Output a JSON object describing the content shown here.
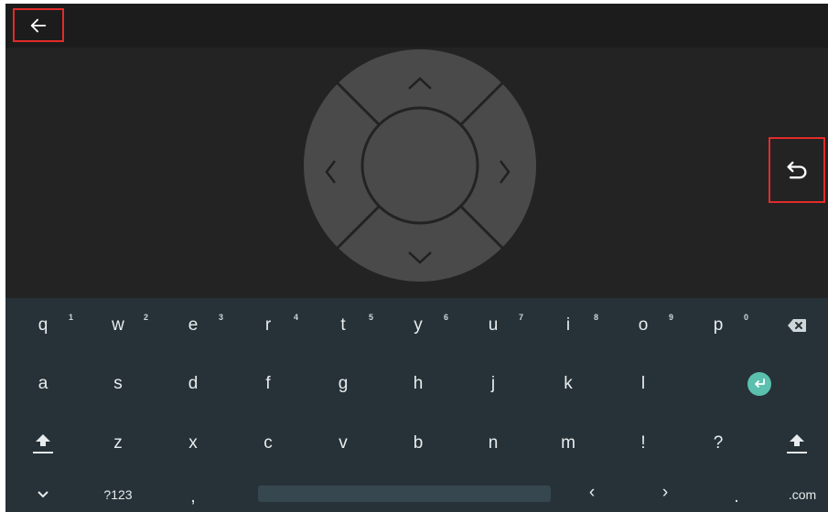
{
  "toolbar": {
    "back_icon": "arrow-left-icon"
  },
  "remote": {
    "dpad": {
      "up_icon": "chevron-up-icon",
      "down_icon": "chevron-down-icon",
      "left_icon": "chevron-left-icon",
      "right_icon": "chevron-right-icon",
      "center_icon": "ok-button"
    },
    "return_icon": "return-icon"
  },
  "keyboard": {
    "row1": [
      {
        "label": "q",
        "hint": "1"
      },
      {
        "label": "w",
        "hint": "2"
      },
      {
        "label": "e",
        "hint": "3"
      },
      {
        "label": "r",
        "hint": "4"
      },
      {
        "label": "t",
        "hint": "5"
      },
      {
        "label": "y",
        "hint": "6"
      },
      {
        "label": "u",
        "hint": "7"
      },
      {
        "label": "i",
        "hint": "8"
      },
      {
        "label": "o",
        "hint": "9"
      },
      {
        "label": "p",
        "hint": "0"
      }
    ],
    "row2": [
      "a",
      "s",
      "d",
      "f",
      "g",
      "h",
      "j",
      "k",
      "l"
    ],
    "row3": [
      "z",
      "x",
      "c",
      "v",
      "b",
      "n",
      "m",
      "!",
      "?"
    ],
    "row4": {
      "collapse_icon": "chevron-down-icon",
      "symbols_label": "?123",
      "comma_label": ",",
      "cursor_left_label": "‹",
      "cursor_right_label": "›",
      "period_label": ".",
      "dotcom_label": ".com"
    },
    "icons": {
      "backspace": "backspace-icon",
      "enter": "enter-icon",
      "shift": "shift-icon"
    },
    "colors": {
      "background": "#263238",
      "enter_accent": "#5bc0ae",
      "highlight_border": "#e32b2b"
    }
  }
}
